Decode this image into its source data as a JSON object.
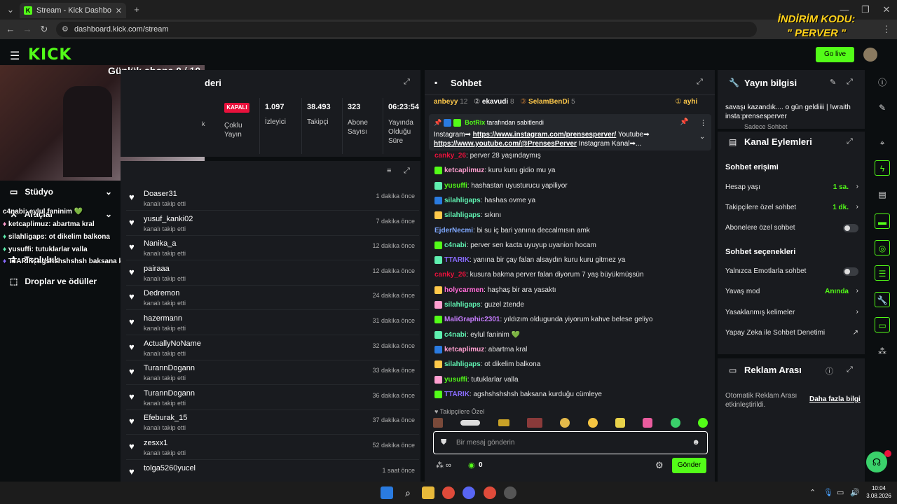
{
  "browser": {
    "tab_title": "Stream - Kick Dashboard",
    "url": "dashboard.kick.com/stream"
  },
  "promo": {
    "line1": "İNDİRİM KODU:",
    "line2": "\" PERVER \""
  },
  "header": {
    "logo": "KICK",
    "go_live": "Go live"
  },
  "overlay": {
    "sub_goal": "Günlük abone 0 / 10",
    "chat": [
      {
        "user": "c4nabi",
        "text": ": eylul faninim 💚"
      },
      {
        "user": "ketcaplimuz",
        "text": ": abartma kral"
      },
      {
        "user": "silahligaps",
        "text": ": ot dikelim balkona"
      },
      {
        "user": "yusuffi",
        "text": ": tutuklarlar valla"
      },
      {
        "user": "TTARIK",
        "text": ": agshshshshsh baksana kurduğu cümleye"
      }
    ]
  },
  "sidebar": {
    "items": [
      {
        "label": "Stüdyo"
      },
      {
        "label": "Araçlar"
      },
      {
        "label": "Topluluk"
      },
      {
        "label": "Droplar ve ödüller"
      }
    ]
  },
  "stats": {
    "title": "deri",
    "status": "KAPALI",
    "multi": "Çoklu Yayın",
    "viewers": {
      "value": "1.097",
      "label": "İzleyici"
    },
    "followers": {
      "value": "38.493",
      "label": "Takipçi"
    },
    "subs": {
      "value": "323",
      "label": "Abone Sayısı"
    },
    "uptime": {
      "value": "06:23:54",
      "label": "Yayında Olduğu Süre"
    },
    "cut_label": "k"
  },
  "activity": [
    {
      "name": "Doaser31",
      "sub": "kanalı takip etti",
      "time": "1 dakika önce"
    },
    {
      "name": "yusuf_kanki02",
      "sub": "kanalı takip etti",
      "time": "7 dakika önce"
    },
    {
      "name": "Nanika_a",
      "sub": "kanalı takip etti",
      "time": "12 dakika önce"
    },
    {
      "name": "pairaaa",
      "sub": "kanalı takip etti",
      "time": "12 dakika önce"
    },
    {
      "name": "Dedremon",
      "sub": "kanalı takip etti",
      "time": "24 dakika önce"
    },
    {
      "name": "hazermann",
      "sub": "kanalı takip etti",
      "time": "31 dakika önce"
    },
    {
      "name": "ActuallyNoName",
      "sub": "kanalı takip etti",
      "time": "32 dakika önce"
    },
    {
      "name": "TurannDogann",
      "sub": "kanalı takip etti",
      "time": "33 dakika önce"
    },
    {
      "name": "TurannDogann",
      "sub": "kanalı takip etti",
      "time": "36 dakika önce"
    },
    {
      "name": "Efeburak_15",
      "sub": "kanalı takip etti",
      "time": "37 dakika önce"
    },
    {
      "name": "zesxx1",
      "sub": "kanalı takip etti",
      "time": "52 dakika önce"
    },
    {
      "name": "tolga5260yucel",
      "sub": "",
      "time": "1 saat önce"
    }
  ],
  "chat": {
    "title": "Sohbet",
    "top_gifters": [
      {
        "name": "anbeyy",
        "count": "12"
      },
      {
        "name": "ekavudi",
        "count": "8"
      },
      {
        "name": "SelamBenDi",
        "count": "5"
      },
      {
        "name": "ayhi",
        "count": ""
      }
    ],
    "pinned_by": "BotRix",
    "pinned_label": "tarafından sabitlendi",
    "pinned_l1_pre": "Instagram➡ ",
    "pinned_l1_link": "https://www.instagram.com/prensesperver/",
    "pinned_l1_post": " Youtube➡",
    "pinned_l2_link": "https://www.youtube.com/@PrensesPerver",
    "pinned_l2_post": " Instagram Kanal➡...",
    "messages": [
      {
        "user": "canky_26",
        "color": "#e9113c",
        "text": ": perver 28 yaşındaymış"
      },
      {
        "user": "ketcaplimuz",
        "color": "#ff9fd0",
        "text": ": kuru kuru gidio mu ya"
      },
      {
        "user": "yusuffi",
        "color": "#53fc18",
        "text": ": hashastan uyusturucu yapiliyor"
      },
      {
        "user": "silahligaps",
        "color": "#5ff0b0",
        "text": ": hashas ovme ya"
      },
      {
        "user": "silahligaps",
        "color": "#5ff0b0",
        "text": ": sıkını"
      },
      {
        "user": "EjderNecmi",
        "color": "#7fa8ff",
        "text": ": bi su iç bari yanına deccalmısın amk"
      },
      {
        "user": "c4nabi",
        "color": "#5ff0b0",
        "text": ": perver sen kacta uyuyup uyanion hocam"
      },
      {
        "user": "TTARIK",
        "color": "#8a6cff",
        "text": ": yanına bir çay falan alsaydın kuru kuru gitmez ya"
      },
      {
        "user": "canky_26",
        "color": "#e9113c",
        "text": ": kusura bakma perver falan diyorum 7 yaş büyükmüşsün"
      },
      {
        "user": "holycarmen",
        "color": "#ff6bd6",
        "text": ": haşhaş bir ara yasaktı"
      },
      {
        "user": "silahligaps",
        "color": "#5ff0b0",
        "text": ": guzel ztende"
      },
      {
        "user": "MaliGraphic2301",
        "color": "#c77dff",
        "text": ": yıldızım oldugunda yiyorum kahve belese geliyo"
      },
      {
        "user": "c4nabi",
        "color": "#5ff0b0",
        "text": ": eylul faninim 💚"
      },
      {
        "user": "ketcaplimuz",
        "color": "#ff9fd0",
        "text": ": abartma kral"
      },
      {
        "user": "silahligaps",
        "color": "#5ff0b0",
        "text": ": ot dikelim balkona"
      },
      {
        "user": "yusuffi",
        "color": "#53fc18",
        "text": ": tutuklarlar valla"
      },
      {
        "user": "TTARIK",
        "color": "#8a6cff",
        "text": ": agshshshshsh baksana kurduğu cümleye"
      }
    ],
    "followers_only": "Takipçilere Özel",
    "input_placeholder": "Bir mesaj gönderin",
    "points": "0",
    "send": "Gönder"
  },
  "stream_info": {
    "title": "Yayın bilgisi",
    "text": "savaşı kazandık.... o gün geldiiii | !wraith insta:prensesperver",
    "cut": "Sadece Sohbet"
  },
  "channel_actions": {
    "title": "Kanal Eylemleri",
    "chat_access": "Sohbet erişimi",
    "account_age": {
      "label": "Hesap yaşı",
      "value": "1 sa."
    },
    "followers_chat": {
      "label": "Takipçilere özel sohbet",
      "value": "1 dk."
    },
    "subs_chat": {
      "label": "Abonelere özel sohbet"
    },
    "chat_options": "Sohbet seçenekleri",
    "emotes_only": {
      "label": "Yalnızca Emotlarla sohbet"
    },
    "slow_mode": {
      "label": "Yavaş mod",
      "value": "Anında"
    },
    "banned_words": {
      "label": "Yasaklanmış kelimeler"
    },
    "ai_moderation": {
      "label": "Yapay Zeka ile Sohbet Denetimi"
    }
  },
  "ad_break": {
    "title": "Reklam Arası",
    "desc": "Otomatik Reklam Arası etkinleştirildi.",
    "link": "Daha fazla bilgi"
  },
  "taskbar": {
    "time": "10:04",
    "date": "3.08.2026"
  },
  "colors": {
    "accent": "#53fc18",
    "panel": "#191b1f",
    "bg": "#0b0e10"
  }
}
